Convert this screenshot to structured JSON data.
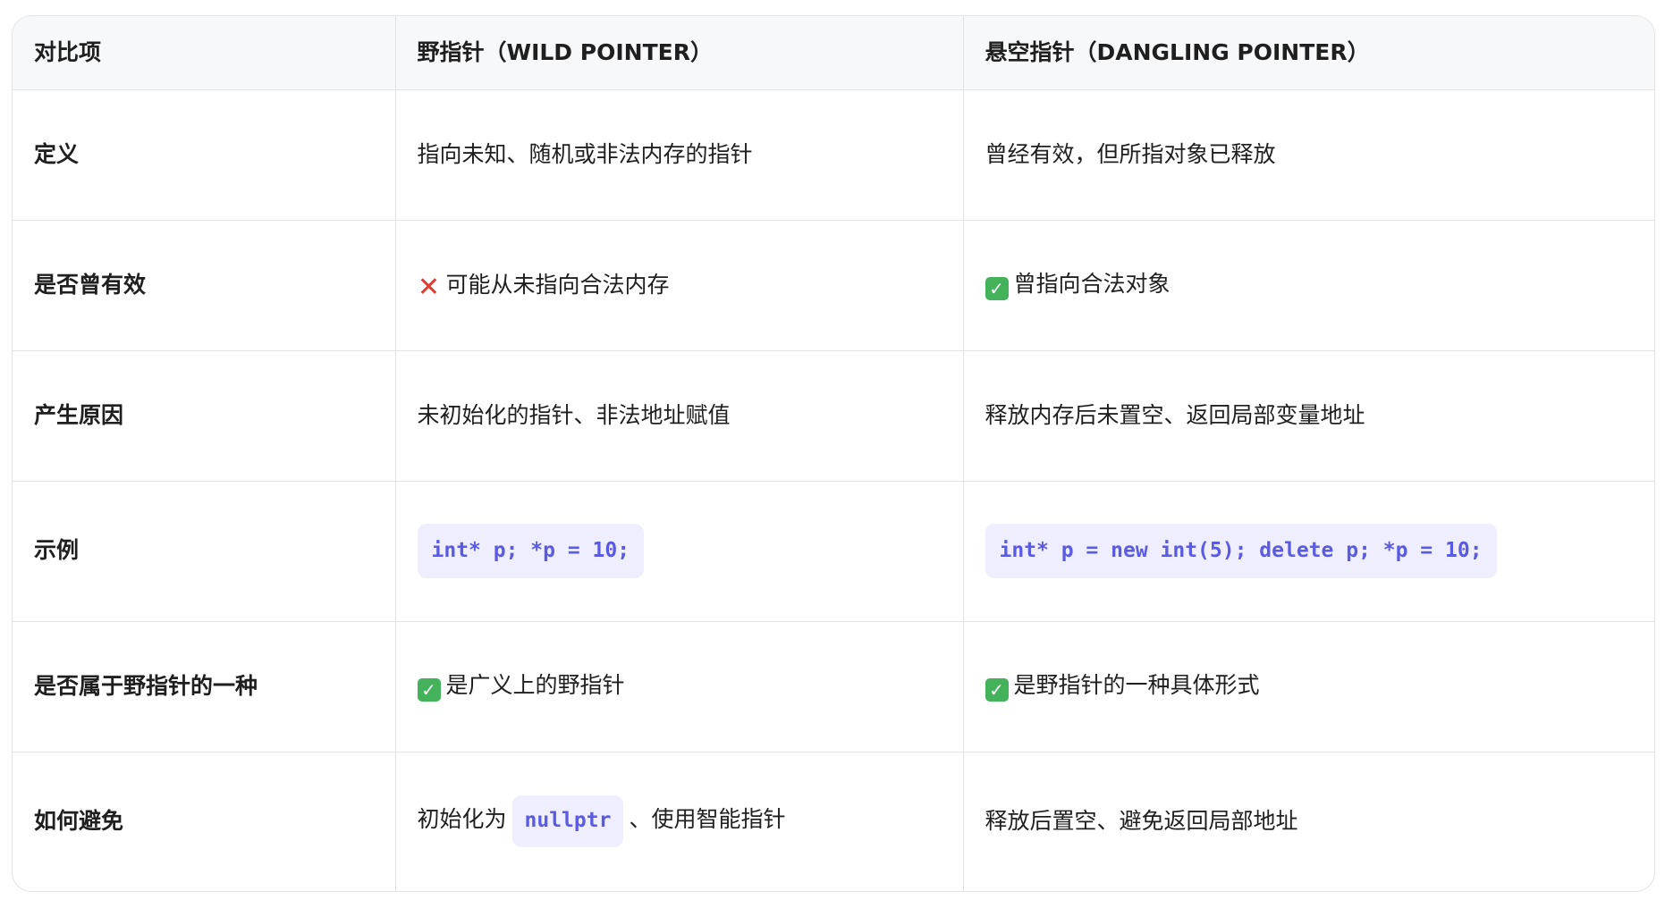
{
  "table": {
    "headers": [
      "对比项",
      "野指针（WILD POINTER）",
      "悬空指针（DANGLING POINTER）"
    ],
    "rows": [
      {
        "label": "定义",
        "wild": "指向未知、随机或非法内存的指针",
        "dangling": "曾经有效，但所指对象已释放"
      },
      {
        "label": "是否曾有效",
        "wild_icon": "cross-mark-icon",
        "wild": "可能从未指向合法内存",
        "dangling_icon": "check-mark-icon",
        "dangling": "曾指向合法对象"
      },
      {
        "label": "产生原因",
        "wild": "未初始化的指针、非法地址赋值",
        "dangling": "释放内存后未置空、返回局部变量地址"
      },
      {
        "label": "示例",
        "wild_code": "int* p; *p = 10;",
        "dangling_code": "int* p = new int(5); delete p; *p = 10;"
      },
      {
        "label": "是否属于野指针的一种",
        "wild_icon": "check-mark-icon",
        "wild": "是广义上的野指针",
        "dangling_icon": "check-mark-icon",
        "dangling": "是野指针的一种具体形式"
      },
      {
        "label": "如何避免",
        "wild_before": "初始化为",
        "wild_code": "nullptr",
        "wild_after": "、使用智能指针",
        "dangling": "释放后置空、避免返回局部地址"
      }
    ]
  },
  "glyphs": {
    "cross": "✕",
    "check": "✓"
  },
  "colors": {
    "code_text": "#5a5be0",
    "code_bg": "#eeeeff",
    "check_bg": "#43b25a",
    "cross": "#e23a2e",
    "header_bg": "#f7f8fa",
    "border": "#e3e3e3"
  }
}
